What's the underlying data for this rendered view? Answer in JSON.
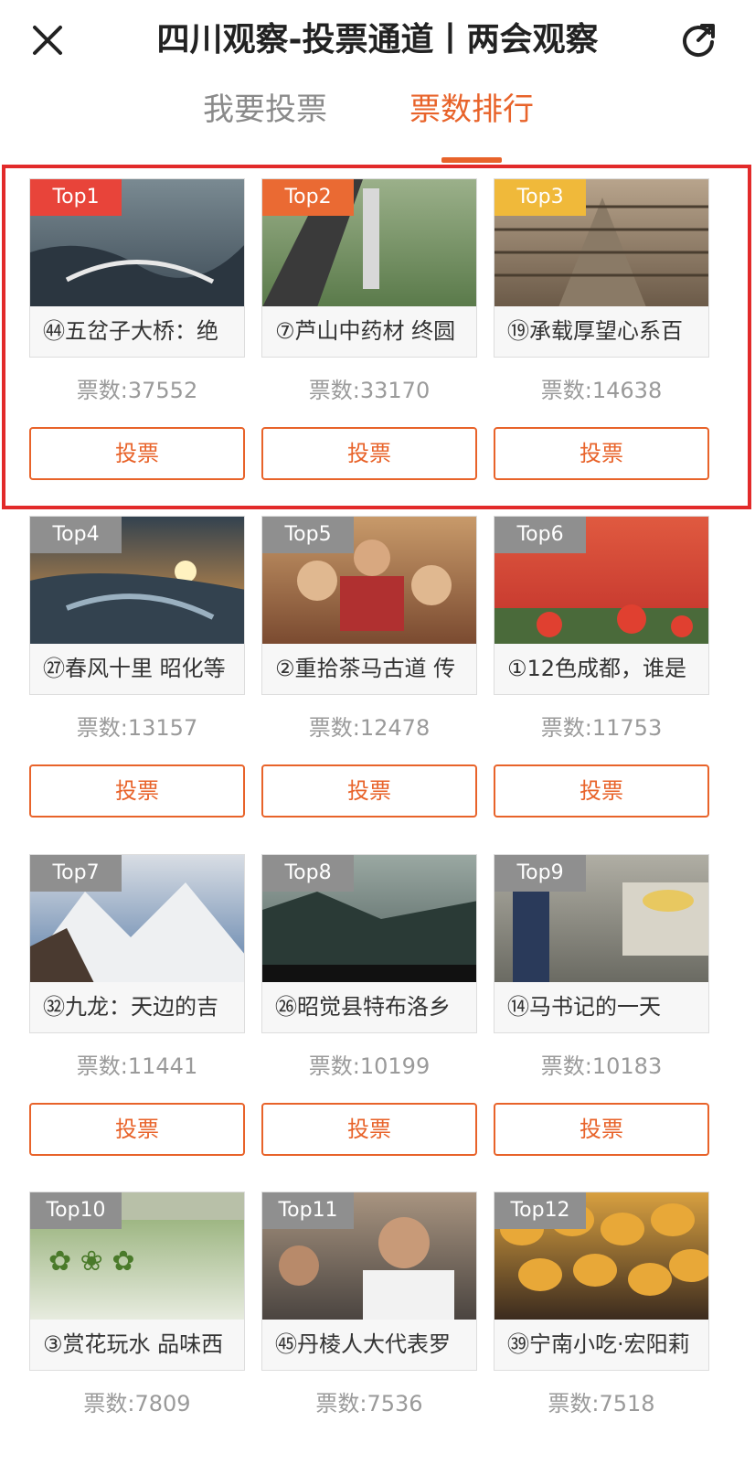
{
  "header": {
    "title": "四川观察-投票通道丨两会观察",
    "close_icon": "close-icon",
    "refresh_icon": "refresh-icon"
  },
  "tabs": [
    {
      "label": "我要投票",
      "active": false
    },
    {
      "label": "票数排行",
      "active": true
    }
  ],
  "colors": {
    "accent": "#e8632a",
    "highlight_border": "#e22a2a",
    "top1": "#e8443a",
    "top2": "#ea6a33",
    "top3": "#f0b93a",
    "other": "#8f8f8f"
  },
  "vote_label": "投票",
  "items": [
    {
      "rank": "Top1",
      "title": "㊹五岔子大桥：绝",
      "votes": "票数:37552"
    },
    {
      "rank": "Top2",
      "title": "⑦芦山中药材 终圆",
      "votes": "票数:33170"
    },
    {
      "rank": "Top3",
      "title": "⑲承载厚望心系百",
      "votes": "票数:14638"
    },
    {
      "rank": "Top4",
      "title": "㉗春风十里 昭化等",
      "votes": "票数:13157"
    },
    {
      "rank": "Top5",
      "title": "②重拾茶马古道 传",
      "votes": "票数:12478"
    },
    {
      "rank": "Top6",
      "title": "①12色成都，谁是",
      "votes": "票数:11753"
    },
    {
      "rank": "Top7",
      "title": "㉜九龙：天边的吉",
      "votes": "票数:11441"
    },
    {
      "rank": "Top8",
      "title": "㉖昭觉县特布洛乡",
      "votes": "票数:10199"
    },
    {
      "rank": "Top9",
      "title": "⑭马书记的一天",
      "votes": "票数:10183"
    },
    {
      "rank": "Top10",
      "title": "③赏花玩水 品味西",
      "votes": "票数:7809"
    },
    {
      "rank": "Top11",
      "title": "㊺丹棱人大代表罗",
      "votes": "票数:7536"
    },
    {
      "rank": "Top12",
      "title": "㊴宁南小吃·宏阳莉",
      "votes": "票数:7518"
    }
  ]
}
